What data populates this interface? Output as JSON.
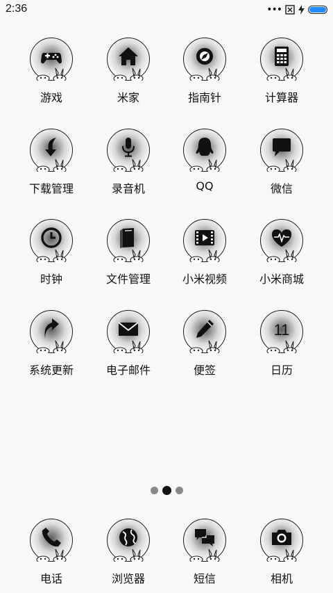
{
  "status_bar": {
    "time": "2:36",
    "icons": [
      "more-dots-icon",
      "no-sim-icon",
      "charging-bolt-icon",
      "battery-icon"
    ],
    "battery_color": "#1f8bff"
  },
  "apps": [
    {
      "label": "游戏",
      "icon": "gamepad-icon"
    },
    {
      "label": "米家",
      "icon": "home-icon"
    },
    {
      "label": "指南针",
      "icon": "compass-icon"
    },
    {
      "label": "计算器",
      "icon": "calculator-icon"
    },
    {
      "label": "下载管理",
      "icon": "download-icon"
    },
    {
      "label": "录音机",
      "icon": "microphone-icon"
    },
    {
      "label": "QQ",
      "icon": "qq-penguin-icon"
    },
    {
      "label": "微信",
      "icon": "chat-bubble-icon"
    },
    {
      "label": "时钟",
      "icon": "clock-icon"
    },
    {
      "label": "文件管理",
      "icon": "folder-book-icon"
    },
    {
      "label": "小米视频",
      "icon": "video-play-icon"
    },
    {
      "label": "小米商城",
      "icon": "heart-pulse-icon"
    },
    {
      "label": "系统更新",
      "icon": "update-arrow-icon"
    },
    {
      "label": "电子邮件",
      "icon": "envelope-icon"
    },
    {
      "label": "便签",
      "icon": "pencil-icon"
    },
    {
      "label": "日历",
      "icon": "calendar-icon",
      "badge_text": "11"
    }
  ],
  "pager": {
    "count": 3,
    "active_index": 1
  },
  "dock": [
    {
      "label": "电话",
      "icon": "phone-icon"
    },
    {
      "label": "浏览器",
      "icon": "globe-icon"
    },
    {
      "label": "短信",
      "icon": "messages-icon"
    },
    {
      "label": "相机",
      "icon": "camera-icon"
    }
  ]
}
